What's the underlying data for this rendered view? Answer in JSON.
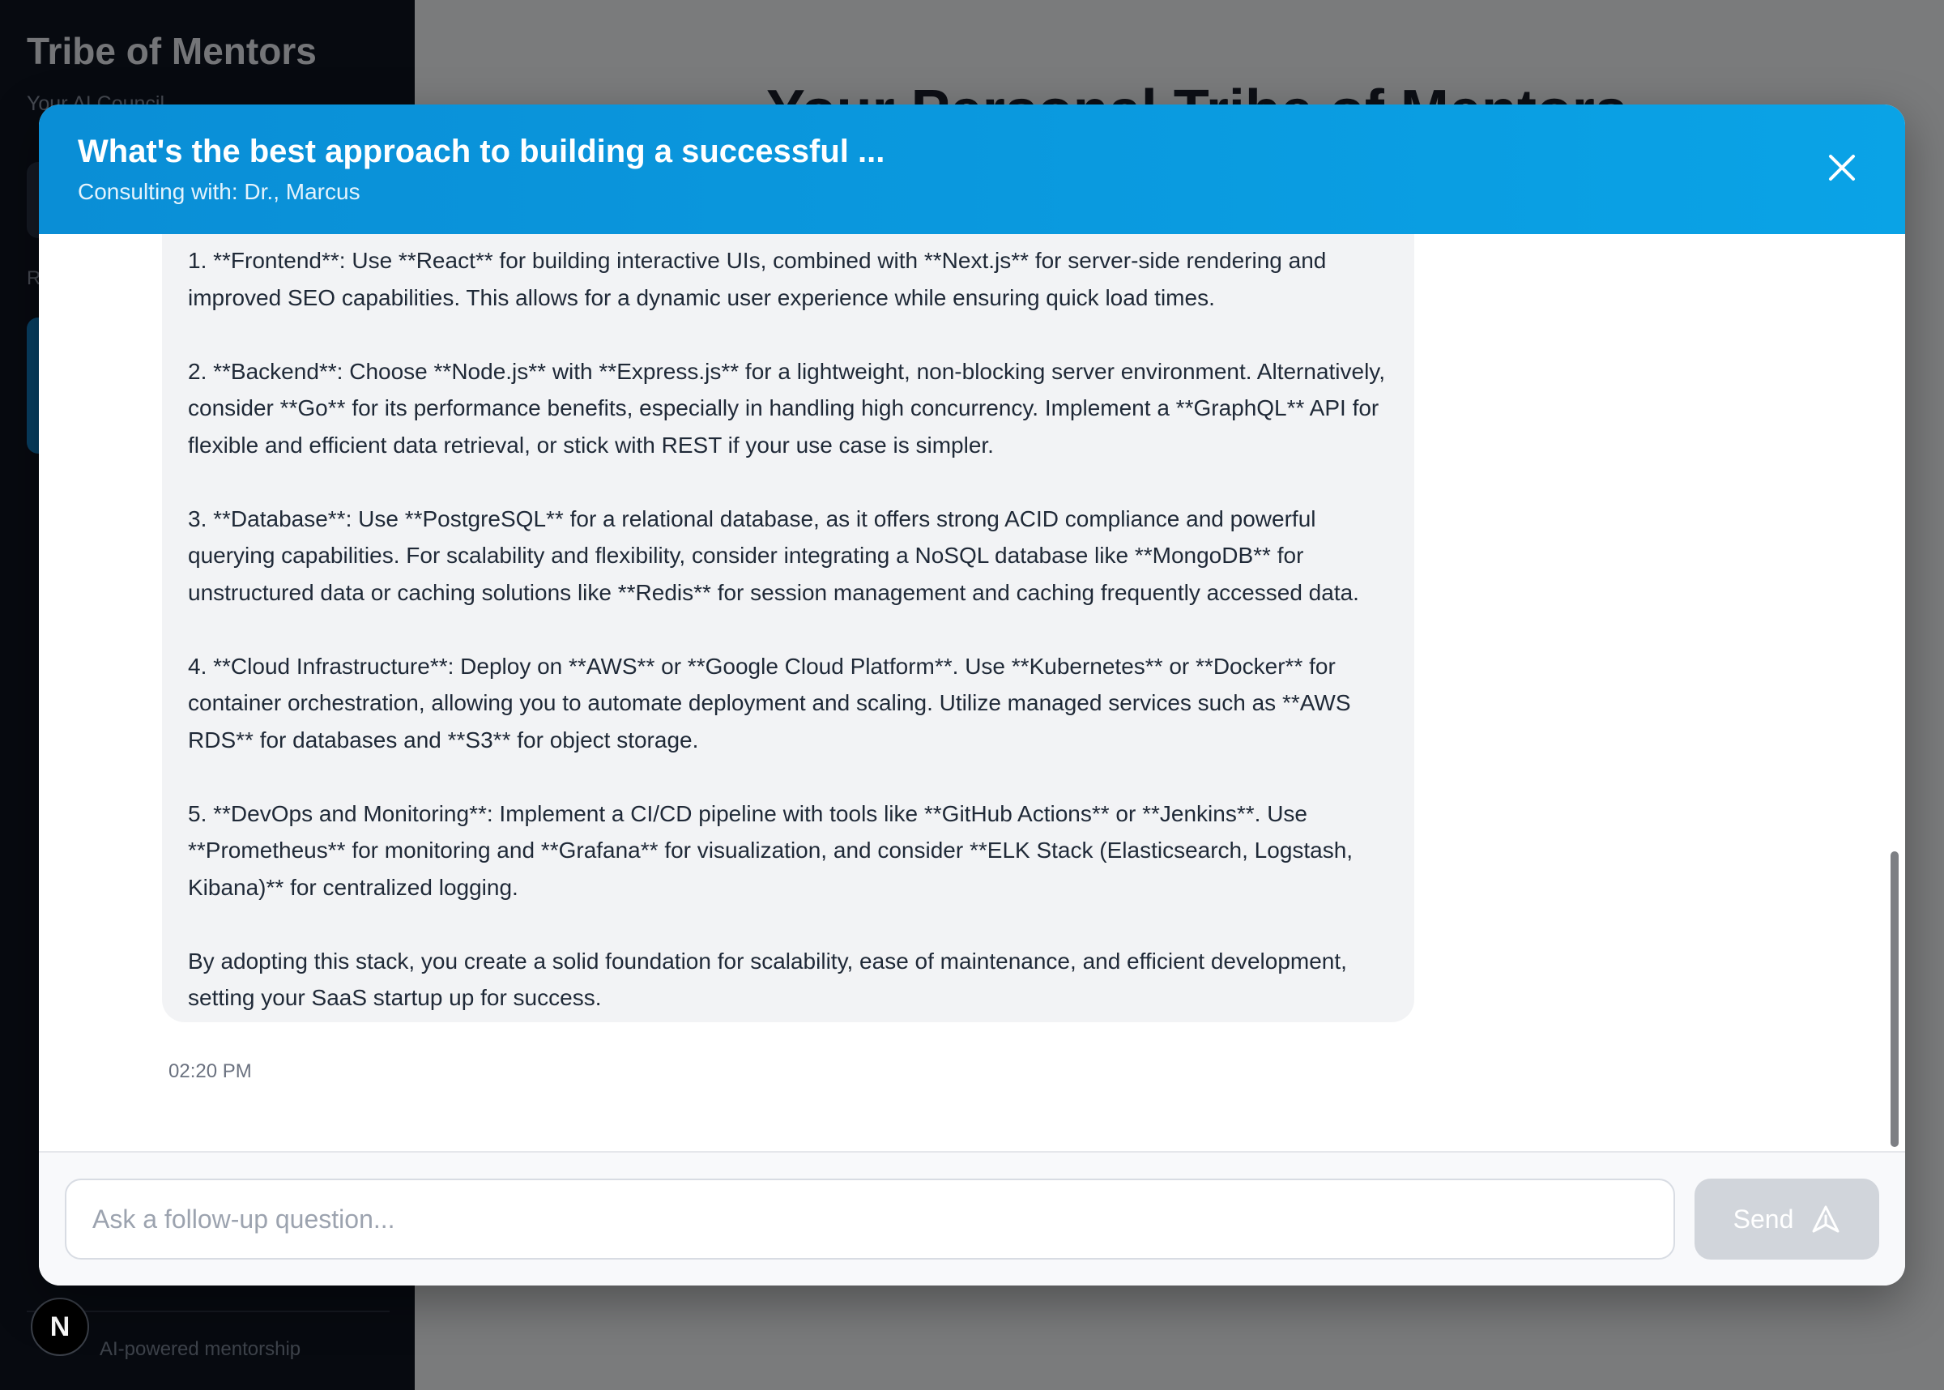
{
  "sidebar": {
    "title": "Tribe of Mentors",
    "subtitle": "Your AI Council",
    "section_label": "R",
    "footer": "AI-powered mentorship",
    "badge": "N"
  },
  "main": {
    "heading": "Your Personal Tribe of Mentors"
  },
  "modal": {
    "title": "What's the best approach to building a successful ...",
    "subtitle": "Consulting with: Dr., Marcus",
    "message": {
      "paragraphs": [
        "1. **Frontend**: Use **React** for building interactive UIs, combined with **Next.js** for server-side rendering and improved SEO capabilities. This allows for a dynamic user experience while ensuring quick load times.",
        "2. **Backend**: Choose **Node.js** with **Express.js** for a lightweight, non-blocking server environment. Alternatively, consider **Go** for its performance benefits, especially in handling high concurrency. Implement a **GraphQL** API for flexible and efficient data retrieval, or stick with REST if your use case is simpler.",
        "3. **Database**: Use **PostgreSQL** for a relational database, as it offers strong ACID compliance and powerful querying capabilities. For scalability and flexibility, consider integrating a NoSQL database like **MongoDB** for unstructured data or caching solutions like **Redis** for session management and caching frequently accessed data.",
        "4. **Cloud Infrastructure**: Deploy on **AWS** or **Google Cloud Platform**. Use **Kubernetes** or **Docker** for container orchestration, allowing you to automate deployment and scaling. Utilize managed services such as **AWS RDS** for databases and **S3** for object storage.",
        "5. **DevOps and Monitoring**: Implement a CI/CD pipeline with tools like **GitHub Actions** or **Jenkins**. Use **Prometheus** for monitoring and **Grafana** for visualization, and consider **ELK Stack (Elasticsearch, Logstash, Kibana)** for centralized logging.",
        "By adopting this stack, you create a solid foundation for scalability, ease of maintenance, and efficient development, setting your SaaS startup up for success."
      ],
      "time": "02:20 PM"
    },
    "composer": {
      "placeholder": "Ask a follow-up question...",
      "value": "",
      "send_label": "Send"
    }
  },
  "icons": {
    "close": "close-icon",
    "send": "send-icon"
  },
  "colors": {
    "header_accent": "#0a9ae0",
    "sidebar_bg": "#0f1521",
    "bubble_bg": "#f2f3f5",
    "send_disabled": "#d1d5db"
  }
}
